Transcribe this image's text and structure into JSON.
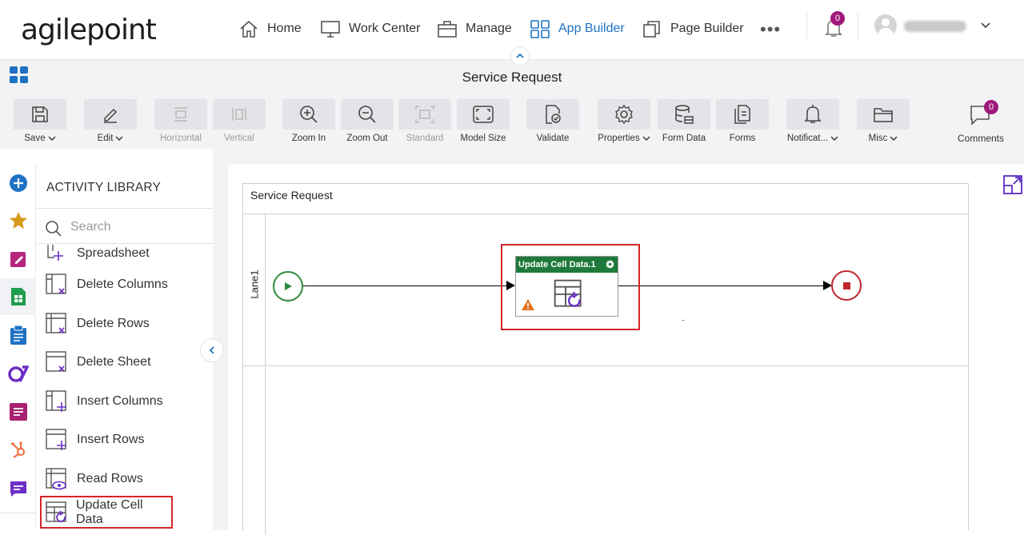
{
  "brand": {
    "logo_text": "agilepoint"
  },
  "nav": {
    "items": [
      {
        "label": "Home",
        "icon": "home-icon"
      },
      {
        "label": "Work Center",
        "icon": "monitor-icon"
      },
      {
        "label": "Manage",
        "icon": "briefcase-icon"
      },
      {
        "label": "App Builder",
        "icon": "grid-icon",
        "active": true
      },
      {
        "label": "Page Builder",
        "icon": "pages-icon"
      }
    ],
    "more": "•••",
    "notifications_count": "0"
  },
  "titlebar": {
    "title": "Service Request"
  },
  "toolbar": {
    "items": [
      {
        "label": "Save",
        "icon": "save-icon",
        "dropdown": true
      },
      {
        "label": "Edit",
        "icon": "pencil-icon",
        "dropdown": true
      },
      {
        "label": "Horizontal",
        "icon": "horizontal-icon",
        "disabled": true
      },
      {
        "label": "Vertical",
        "icon": "vertical-icon",
        "disabled": true
      },
      {
        "label": "Zoom In",
        "icon": "zoom-in-icon"
      },
      {
        "label": "Zoom Out",
        "icon": "zoom-out-icon"
      },
      {
        "label": "Standard",
        "icon": "standard-icon",
        "disabled": true
      },
      {
        "label": "Model Size",
        "icon": "model-size-icon"
      },
      {
        "label": "Validate",
        "icon": "validate-icon"
      },
      {
        "label": "Properties",
        "icon": "gear-icon",
        "dropdown": true
      },
      {
        "label": "Form Data",
        "icon": "database-icon"
      },
      {
        "label": "Forms",
        "icon": "forms-icon"
      },
      {
        "label": "Notificat...",
        "icon": "bell-icon",
        "dropdown": true
      },
      {
        "label": "Misc",
        "icon": "folder-icon",
        "dropdown": true
      }
    ],
    "comments": {
      "label": "Comments",
      "count": "0"
    }
  },
  "library": {
    "title": "ACTIVITY LIBRARY",
    "search_placeholder": "Search",
    "items": [
      {
        "label": "Spreadsheet"
      },
      {
        "label": "Delete Columns"
      },
      {
        "label": "Delete Rows"
      },
      {
        "label": "Delete Sheet"
      },
      {
        "label": "Insert Columns"
      },
      {
        "label": "Insert Rows"
      },
      {
        "label": "Read Rows"
      },
      {
        "label": "Update Cell Data",
        "highlighted": true
      }
    ]
  },
  "process": {
    "pool_title": "Service Request",
    "lane_label": "Lane1",
    "activity_title": "Update Cell Data.1"
  },
  "colors": {
    "accent": "#1e72c4",
    "badge": "#a0197a",
    "activity_header": "#1e7a3a",
    "start": "#2e8b3c",
    "end": "#c0272d",
    "highlight": "#d4252a"
  }
}
